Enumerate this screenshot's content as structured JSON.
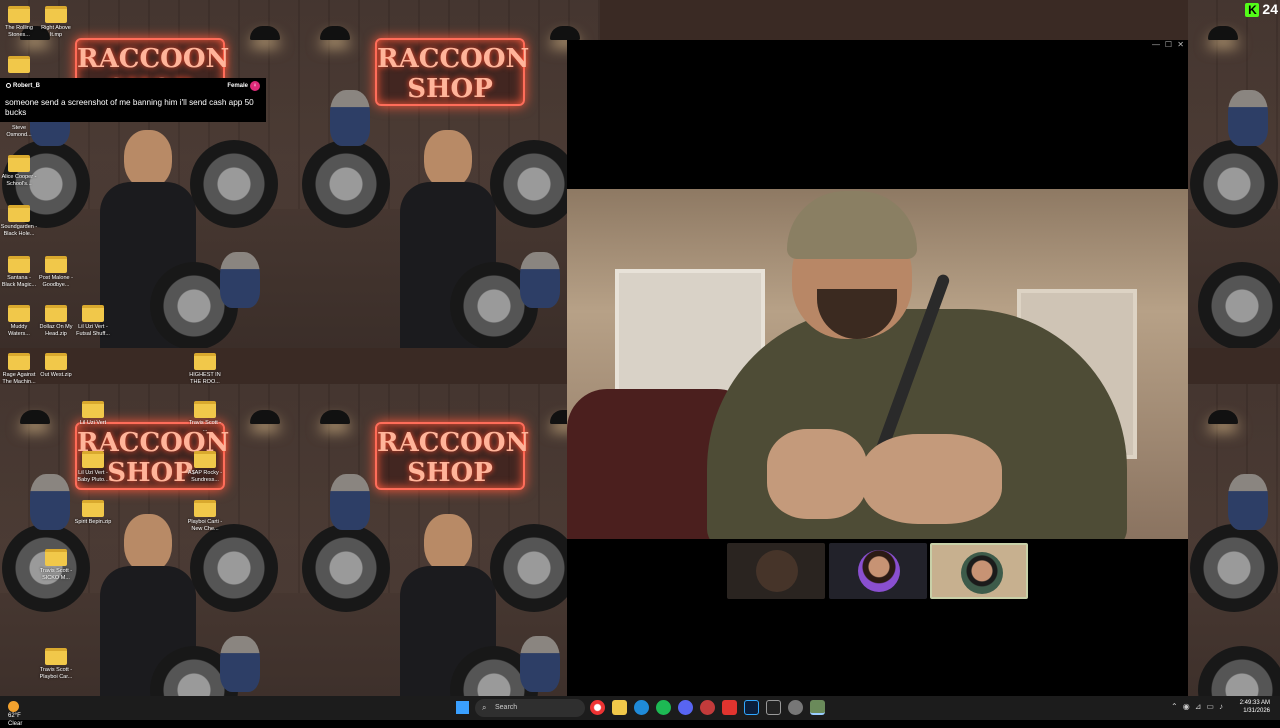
{
  "wallpaper": {
    "sign_text": "RACCOON SHOP"
  },
  "desktop_icons": [
    {
      "label": "The Rolling Stones...",
      "x": "a"
    },
    {
      "label": "Right Above It.mp",
      "x": "b"
    },
    {
      "label": "Steve Osmond...",
      "x": "c"
    },
    {
      "label": "Alice Cooper - School's...",
      "x": "d"
    },
    {
      "label": "Soundgarden - Black Hole...",
      "x": "e"
    },
    {
      "label": "Santana - Black Magic...",
      "x": "f"
    },
    {
      "label": "Post Malone - Goodbye...",
      "x": "g"
    },
    {
      "label": "Muddy Waters...",
      "x": "h"
    },
    {
      "label": "Dollaz On My Head.zip",
      "x": "i"
    },
    {
      "label": "Lil Uzi Vert - Futsal Shuff...",
      "x": "j"
    },
    {
      "label": "Rage Against The Machin...",
      "x": "k"
    },
    {
      "label": "Out West.zip",
      "x": "l"
    },
    {
      "label": "HIGHEST IN THE ROO...",
      "x": "m"
    },
    {
      "label": "Lil Uzi Vert",
      "x": "n"
    },
    {
      "label": "Travis Scott - ...",
      "x": "o"
    },
    {
      "label": "Lil Uzi Vert - Baby Pluto...",
      "x": "p"
    },
    {
      "label": "A$AP Rocky - Sundress...",
      "x": "q"
    },
    {
      "label": "Spirit Bepin.zip",
      "x": "r"
    },
    {
      "label": "Playboi Carti - New Che...",
      "x": "s"
    },
    {
      "label": "Travis Scott - SICKO M...",
      "x": "t"
    },
    {
      "label": "Travis Scott - Playboi Car...",
      "x": "u"
    }
  ],
  "chat": {
    "username": "Robert_B",
    "gender_label": "Female",
    "message": "someone send a screenshot of me banning him i'll send cash app 50 bucks"
  },
  "kick": {
    "logo_letter": "K",
    "count": "24"
  },
  "video_window": {
    "controls": [
      "—",
      "☐",
      "✕"
    ],
    "participants": [
      {
        "name": "camera-off-participant",
        "state": "camera-off"
      },
      {
        "name": "participant-avatar-woman",
        "state": "avatar"
      },
      {
        "name": "participant-avatar-man",
        "state": "avatar-selected"
      }
    ]
  },
  "taskbar": {
    "weather_temp": "62°F",
    "weather_desc": "Clear",
    "search_placeholder": "Search",
    "time": "2:49:33 AM",
    "date": "1/31/2026"
  },
  "colors": {
    "kick_green": "#53fc18",
    "neon": "#ff6d5a",
    "taskbar": "#1c1c1c",
    "selected_thumb_border": "#c8d0a8"
  }
}
